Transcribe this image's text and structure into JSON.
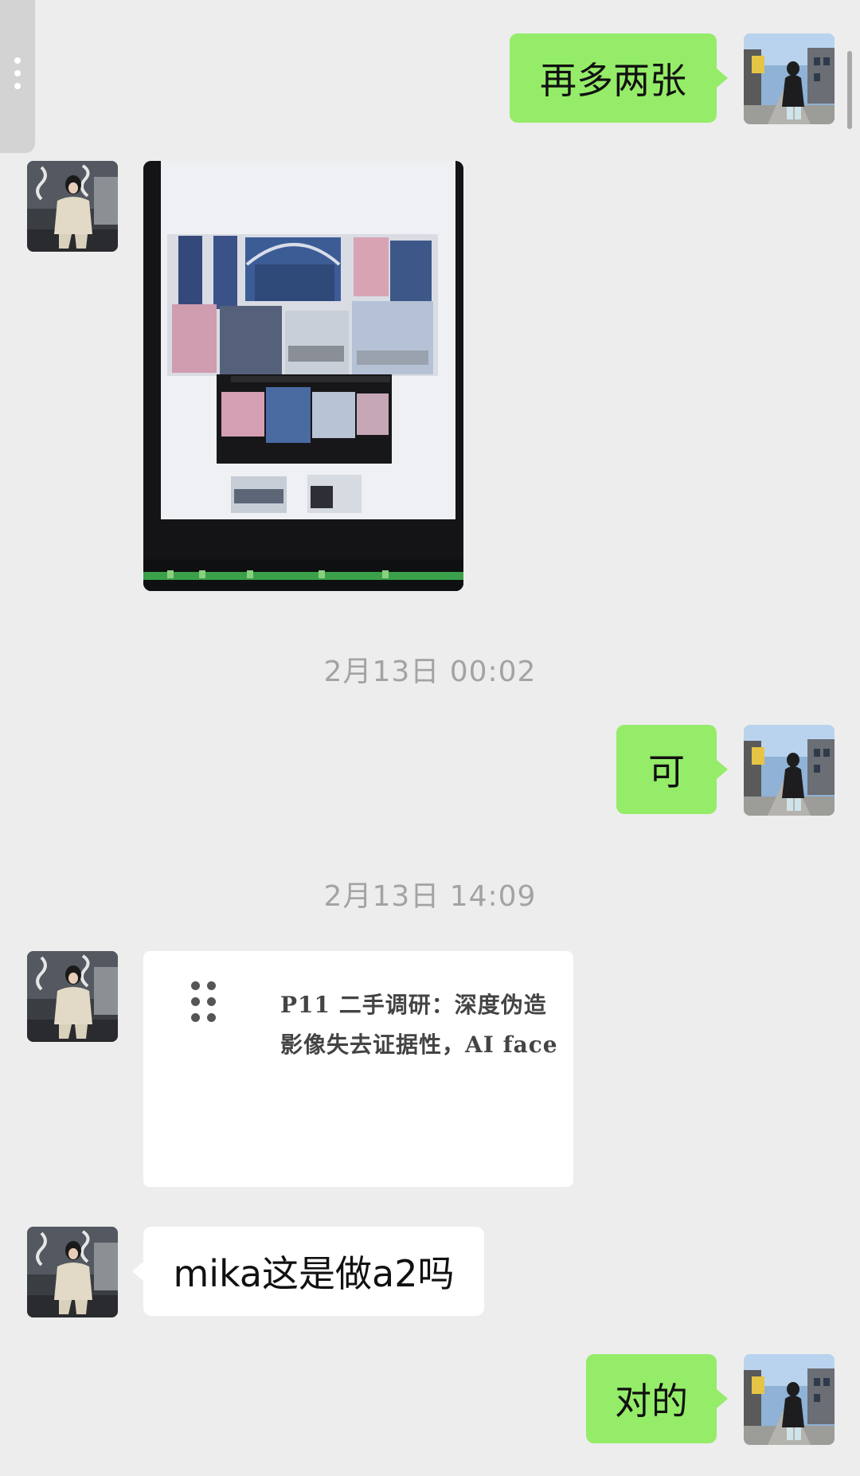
{
  "messages": {
    "m1": {
      "text": "再多两张"
    },
    "m2": {
      "text": "可"
    },
    "m3": {
      "text": "mika这是做a2吗"
    },
    "m4": {
      "text": "对的"
    }
  },
  "timestamps": {
    "t1": "2月13日 00:02",
    "t2": "2月13日 14:09"
  },
  "file_preview": {
    "line1": "P11 二手调研：深度伪造",
    "line2": "影像失去证据性，AI face"
  },
  "colors": {
    "background": "#ededed",
    "sent_bubble": "#95ec69",
    "received_bubble": "#ffffff",
    "timestamp_text": "#a3a3a3"
  },
  "icons": {
    "side_handle": "more-vertical-icon",
    "file_card": "drag-grip-icon"
  }
}
